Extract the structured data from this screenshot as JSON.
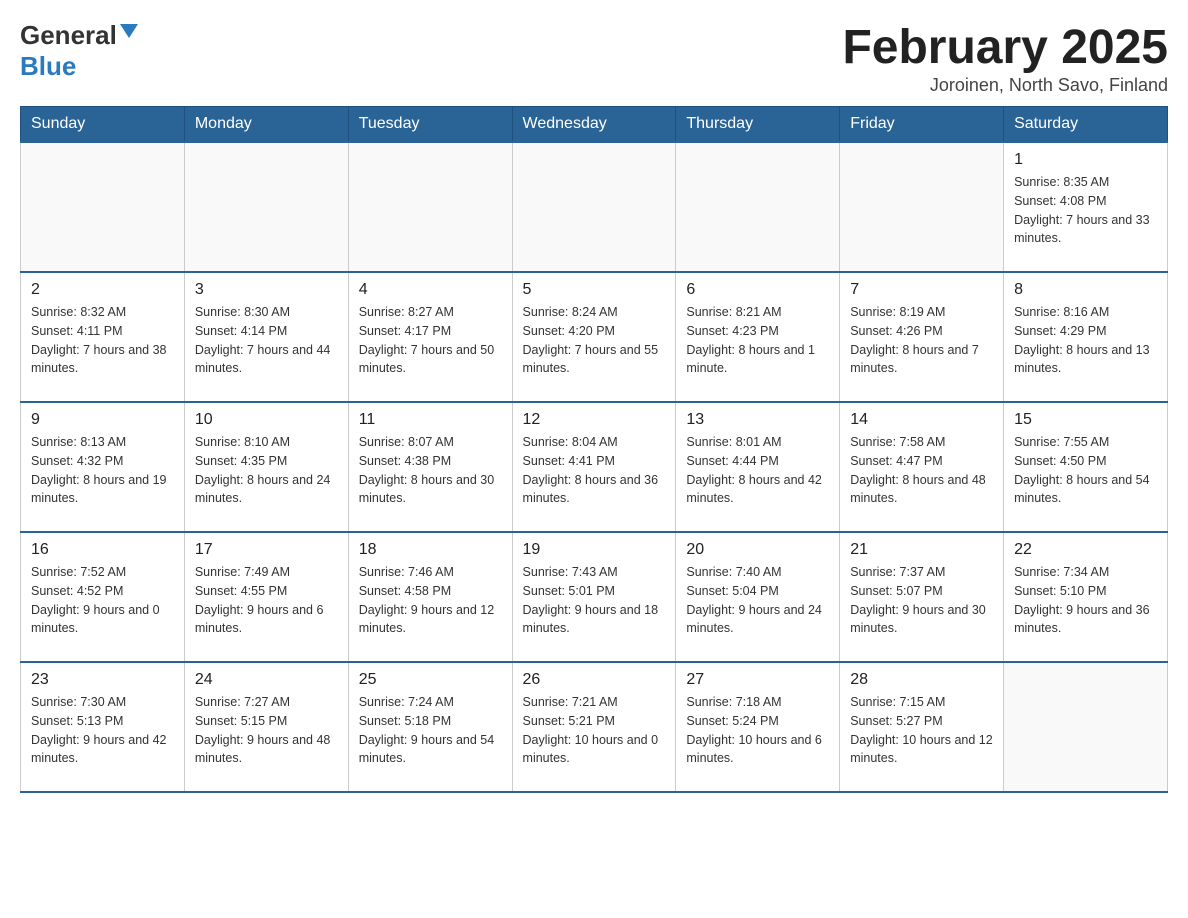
{
  "header": {
    "logo": {
      "general_text": "General",
      "blue_text": "Blue"
    },
    "title": "February 2025",
    "subtitle": "Joroinen, North Savo, Finland"
  },
  "weekdays": [
    "Sunday",
    "Monday",
    "Tuesday",
    "Wednesday",
    "Thursday",
    "Friday",
    "Saturday"
  ],
  "weeks": [
    [
      {
        "day": "",
        "sunrise": "",
        "sunset": "",
        "daylight": ""
      },
      {
        "day": "",
        "sunrise": "",
        "sunset": "",
        "daylight": ""
      },
      {
        "day": "",
        "sunrise": "",
        "sunset": "",
        "daylight": ""
      },
      {
        "day": "",
        "sunrise": "",
        "sunset": "",
        "daylight": ""
      },
      {
        "day": "",
        "sunrise": "",
        "sunset": "",
        "daylight": ""
      },
      {
        "day": "",
        "sunrise": "",
        "sunset": "",
        "daylight": ""
      },
      {
        "day": "1",
        "sunrise": "Sunrise: 8:35 AM",
        "sunset": "Sunset: 4:08 PM",
        "daylight": "Daylight: 7 hours and 33 minutes."
      }
    ],
    [
      {
        "day": "2",
        "sunrise": "Sunrise: 8:32 AM",
        "sunset": "Sunset: 4:11 PM",
        "daylight": "Daylight: 7 hours and 38 minutes."
      },
      {
        "day": "3",
        "sunrise": "Sunrise: 8:30 AM",
        "sunset": "Sunset: 4:14 PM",
        "daylight": "Daylight: 7 hours and 44 minutes."
      },
      {
        "day": "4",
        "sunrise": "Sunrise: 8:27 AM",
        "sunset": "Sunset: 4:17 PM",
        "daylight": "Daylight: 7 hours and 50 minutes."
      },
      {
        "day": "5",
        "sunrise": "Sunrise: 8:24 AM",
        "sunset": "Sunset: 4:20 PM",
        "daylight": "Daylight: 7 hours and 55 minutes."
      },
      {
        "day": "6",
        "sunrise": "Sunrise: 8:21 AM",
        "sunset": "Sunset: 4:23 PM",
        "daylight": "Daylight: 8 hours and 1 minute."
      },
      {
        "day": "7",
        "sunrise": "Sunrise: 8:19 AM",
        "sunset": "Sunset: 4:26 PM",
        "daylight": "Daylight: 8 hours and 7 minutes."
      },
      {
        "day": "8",
        "sunrise": "Sunrise: 8:16 AM",
        "sunset": "Sunset: 4:29 PM",
        "daylight": "Daylight: 8 hours and 13 minutes."
      }
    ],
    [
      {
        "day": "9",
        "sunrise": "Sunrise: 8:13 AM",
        "sunset": "Sunset: 4:32 PM",
        "daylight": "Daylight: 8 hours and 19 minutes."
      },
      {
        "day": "10",
        "sunrise": "Sunrise: 8:10 AM",
        "sunset": "Sunset: 4:35 PM",
        "daylight": "Daylight: 8 hours and 24 minutes."
      },
      {
        "day": "11",
        "sunrise": "Sunrise: 8:07 AM",
        "sunset": "Sunset: 4:38 PM",
        "daylight": "Daylight: 8 hours and 30 minutes."
      },
      {
        "day": "12",
        "sunrise": "Sunrise: 8:04 AM",
        "sunset": "Sunset: 4:41 PM",
        "daylight": "Daylight: 8 hours and 36 minutes."
      },
      {
        "day": "13",
        "sunrise": "Sunrise: 8:01 AM",
        "sunset": "Sunset: 4:44 PM",
        "daylight": "Daylight: 8 hours and 42 minutes."
      },
      {
        "day": "14",
        "sunrise": "Sunrise: 7:58 AM",
        "sunset": "Sunset: 4:47 PM",
        "daylight": "Daylight: 8 hours and 48 minutes."
      },
      {
        "day": "15",
        "sunrise": "Sunrise: 7:55 AM",
        "sunset": "Sunset: 4:50 PM",
        "daylight": "Daylight: 8 hours and 54 minutes."
      }
    ],
    [
      {
        "day": "16",
        "sunrise": "Sunrise: 7:52 AM",
        "sunset": "Sunset: 4:52 PM",
        "daylight": "Daylight: 9 hours and 0 minutes."
      },
      {
        "day": "17",
        "sunrise": "Sunrise: 7:49 AM",
        "sunset": "Sunset: 4:55 PM",
        "daylight": "Daylight: 9 hours and 6 minutes."
      },
      {
        "day": "18",
        "sunrise": "Sunrise: 7:46 AM",
        "sunset": "Sunset: 4:58 PM",
        "daylight": "Daylight: 9 hours and 12 minutes."
      },
      {
        "day": "19",
        "sunrise": "Sunrise: 7:43 AM",
        "sunset": "Sunset: 5:01 PM",
        "daylight": "Daylight: 9 hours and 18 minutes."
      },
      {
        "day": "20",
        "sunrise": "Sunrise: 7:40 AM",
        "sunset": "Sunset: 5:04 PM",
        "daylight": "Daylight: 9 hours and 24 minutes."
      },
      {
        "day": "21",
        "sunrise": "Sunrise: 7:37 AM",
        "sunset": "Sunset: 5:07 PM",
        "daylight": "Daylight: 9 hours and 30 minutes."
      },
      {
        "day": "22",
        "sunrise": "Sunrise: 7:34 AM",
        "sunset": "Sunset: 5:10 PM",
        "daylight": "Daylight: 9 hours and 36 minutes."
      }
    ],
    [
      {
        "day": "23",
        "sunrise": "Sunrise: 7:30 AM",
        "sunset": "Sunset: 5:13 PM",
        "daylight": "Daylight: 9 hours and 42 minutes."
      },
      {
        "day": "24",
        "sunrise": "Sunrise: 7:27 AM",
        "sunset": "Sunset: 5:15 PM",
        "daylight": "Daylight: 9 hours and 48 minutes."
      },
      {
        "day": "25",
        "sunrise": "Sunrise: 7:24 AM",
        "sunset": "Sunset: 5:18 PM",
        "daylight": "Daylight: 9 hours and 54 minutes."
      },
      {
        "day": "26",
        "sunrise": "Sunrise: 7:21 AM",
        "sunset": "Sunset: 5:21 PM",
        "daylight": "Daylight: 10 hours and 0 minutes."
      },
      {
        "day": "27",
        "sunrise": "Sunrise: 7:18 AM",
        "sunset": "Sunset: 5:24 PM",
        "daylight": "Daylight: 10 hours and 6 minutes."
      },
      {
        "day": "28",
        "sunrise": "Sunrise: 7:15 AM",
        "sunset": "Sunset: 5:27 PM",
        "daylight": "Daylight: 10 hours and 12 minutes."
      },
      {
        "day": "",
        "sunrise": "",
        "sunset": "",
        "daylight": ""
      }
    ]
  ]
}
